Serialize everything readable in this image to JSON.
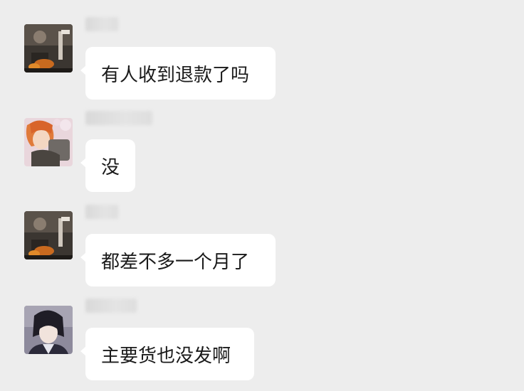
{
  "messages": [
    {
      "text": "有人收到退款了吗",
      "avatar_icon": "dark-figure-avatar-icon"
    },
    {
      "text": "没",
      "avatar_icon": "orange-hair-anime-avatar-icon"
    },
    {
      "text": "都差不多一个月了",
      "avatar_icon": "dark-figure-avatar-icon"
    },
    {
      "text": "主要货也没发啊",
      "avatar_icon": "dark-hair-anime-avatar-icon"
    }
  ]
}
